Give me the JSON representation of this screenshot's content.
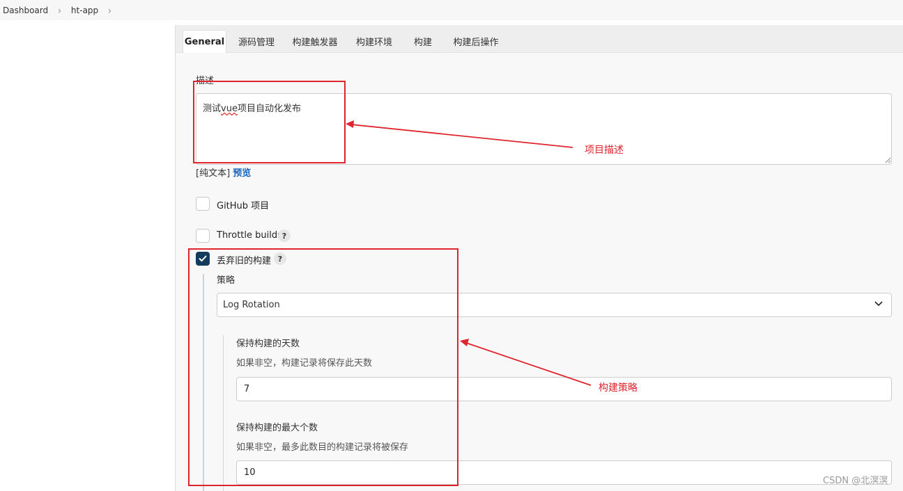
{
  "breadcrumb": {
    "items": [
      "Dashboard",
      "ht-app"
    ]
  },
  "tabs": [
    "General",
    "源码管理",
    "构建触发器",
    "构建环境",
    "构建",
    "构建后操作"
  ],
  "description": {
    "label": "描述",
    "value_prefix": "测试",
    "value_wavy": "vue",
    "value_suffix": "项目自动化发布",
    "plain_text": "[纯文本]",
    "preview": "预览"
  },
  "options": {
    "github_label": "GitHub 项目",
    "throttle_label": "Throttle builds",
    "discard_label": "丢弃旧的构建",
    "help_glyph": "?"
  },
  "strategy": {
    "label": "策略",
    "selected": "Log Rotation",
    "days_label": "保持构建的天数",
    "days_hint": "如果非空，构建记录将保存此天数",
    "days_value": "7",
    "max_label": "保持构建的最大个数",
    "max_hint": "如果非空，最多此数目的构建记录将被保存",
    "max_value": "10"
  },
  "annotations": {
    "description_note": "项目描述",
    "strategy_note": "构建策略",
    "color": "#e0242c"
  },
  "watermark": "CSDN @北溟溟",
  "colors": {
    "checkbox_checked": "#143b5c",
    "link": "#1565c0"
  }
}
